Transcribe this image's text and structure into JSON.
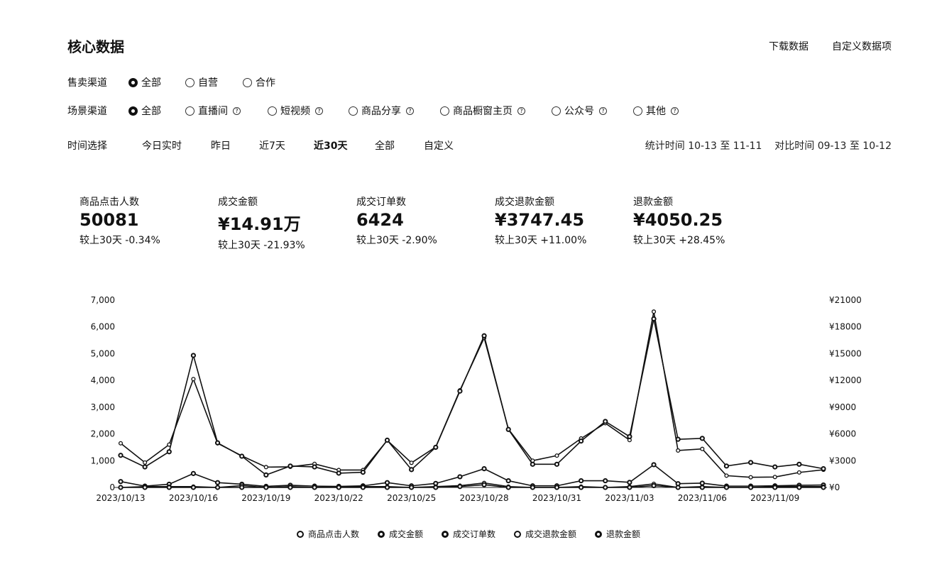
{
  "header": {
    "title": "核心数据",
    "download": "下载数据",
    "customize": "自定义数据项"
  },
  "sales_channel": {
    "label": "售卖渠道",
    "options": [
      "全部",
      "自营",
      "合作"
    ],
    "selected": 0
  },
  "scene_channel": {
    "label": "场景渠道",
    "options": [
      "全部",
      "直播间",
      "短视频",
      "商品分享",
      "商品橱窗主页",
      "公众号",
      "其他"
    ],
    "selected": 0
  },
  "time": {
    "label": "时间选择",
    "options": [
      "今日实时",
      "昨日",
      "近7天",
      "近30天",
      "全部",
      "自定义"
    ],
    "selected": 3,
    "stat_period": "统计时间 10-13 至 11-11",
    "compare_period": "对比时间 09-13 至 10-12"
  },
  "metrics": [
    {
      "label": "商品点击人数",
      "value": "50081",
      "compare": "较上30天 -0.34%"
    },
    {
      "label": "成交金额",
      "value": "¥14.91万",
      "compare": "较上30天 -21.93%"
    },
    {
      "label": "成交订单数",
      "value": "6424",
      "compare": "较上30天 -2.90%"
    },
    {
      "label": "成交退款金额",
      "value": "¥3747.45",
      "compare": "较上30天 +11.00%"
    },
    {
      "label": "退款金额",
      "value": "¥4050.25",
      "compare": "较上30天 +28.45%"
    }
  ],
  "chart_data": {
    "type": "line",
    "x": [
      "2023/10/13",
      "2023/10/14",
      "2023/10/15",
      "2023/10/16",
      "2023/10/17",
      "2023/10/18",
      "2023/10/19",
      "2023/10/20",
      "2023/10/21",
      "2023/10/22",
      "2023/10/23",
      "2023/10/24",
      "2023/10/25",
      "2023/10/26",
      "2023/10/27",
      "2023/10/28",
      "2023/10/29",
      "2023/10/30",
      "2023/10/31",
      "2023/11/01",
      "2023/11/02",
      "2023/11/03",
      "2023/11/04",
      "2023/11/05",
      "2023/11/06",
      "2023/11/07",
      "2023/11/08",
      "2023/11/09",
      "2023/11/10",
      "2023/11/11"
    ],
    "x_tick_labels": [
      "2023/10/13",
      "2023/10/16",
      "2023/10/19",
      "2023/10/22",
      "2023/10/25",
      "2023/10/28",
      "2023/10/31",
      "2023/11/03",
      "2023/11/06",
      "2023/11/09"
    ],
    "y_left": {
      "ticks": [
        "0",
        "1,000",
        "2,000",
        "3,000",
        "4,000",
        "5,000",
        "6,000",
        "7,000"
      ],
      "ylim": [
        0,
        7000
      ]
    },
    "y_right": {
      "ticks": [
        "¥0",
        "¥3000",
        "¥6000",
        "¥9000",
        "¥12000",
        "¥15000",
        "¥18000",
        "¥21000"
      ],
      "ylim": [
        0,
        21000
      ]
    },
    "series": [
      {
        "name": "商品点击人数",
        "axis": "left",
        "marker": "hollow",
        "values": [
          1650,
          930,
          1600,
          4050,
          1650,
          1180,
          760,
          770,
          880,
          650,
          650,
          1760,
          920,
          1510,
          3630,
          5590,
          2180,
          1000,
          1190,
          1830,
          2400,
          1770,
          6570,
          1380,
          1440,
          440,
          380,
          390,
          560,
          660
        ]
      },
      {
        "name": "成交金额",
        "axis": "right",
        "marker": "filled",
        "values": [
          3600,
          2300,
          4000,
          14800,
          5000,
          3500,
          1400,
          2400,
          2300,
          1600,
          1700,
          5300,
          2000,
          4500,
          10800,
          17000,
          6500,
          2600,
          2600,
          5200,
          7400,
          5700,
          18900,
          5400,
          5500,
          2400,
          2800,
          2300,
          2600,
          2100
        ]
      },
      {
        "name": "成交订单数",
        "axis": "left",
        "marker": "filled",
        "values": [
          220,
          50,
          120,
          520,
          180,
          120,
          40,
          80,
          50,
          40,
          60,
          180,
          60,
          150,
          400,
          700,
          250,
          60,
          60,
          250,
          250,
          190,
          850,
          140,
          160,
          50,
          50,
          60,
          80,
          90
        ]
      },
      {
        "name": "成交退款金额",
        "axis": "right",
        "marker": "hollow",
        "values": [
          0,
          100,
          100,
          100,
          0,
          200,
          0,
          100,
          0,
          100,
          100,
          100,
          0,
          100,
          200,
          500,
          100,
          0,
          0,
          100,
          0,
          100,
          400,
          0,
          100,
          0,
          0,
          100,
          100,
          100
        ]
      },
      {
        "name": "退款金额",
        "axis": "right",
        "marker": "filled",
        "values": [
          0,
          0,
          0,
          0,
          0,
          0,
          0,
          0,
          0,
          0,
          0,
          0,
          0,
          0,
          100,
          300,
          0,
          0,
          0,
          0,
          0,
          0,
          200,
          0,
          0,
          0,
          0,
          0,
          0,
          0
        ]
      }
    ]
  }
}
